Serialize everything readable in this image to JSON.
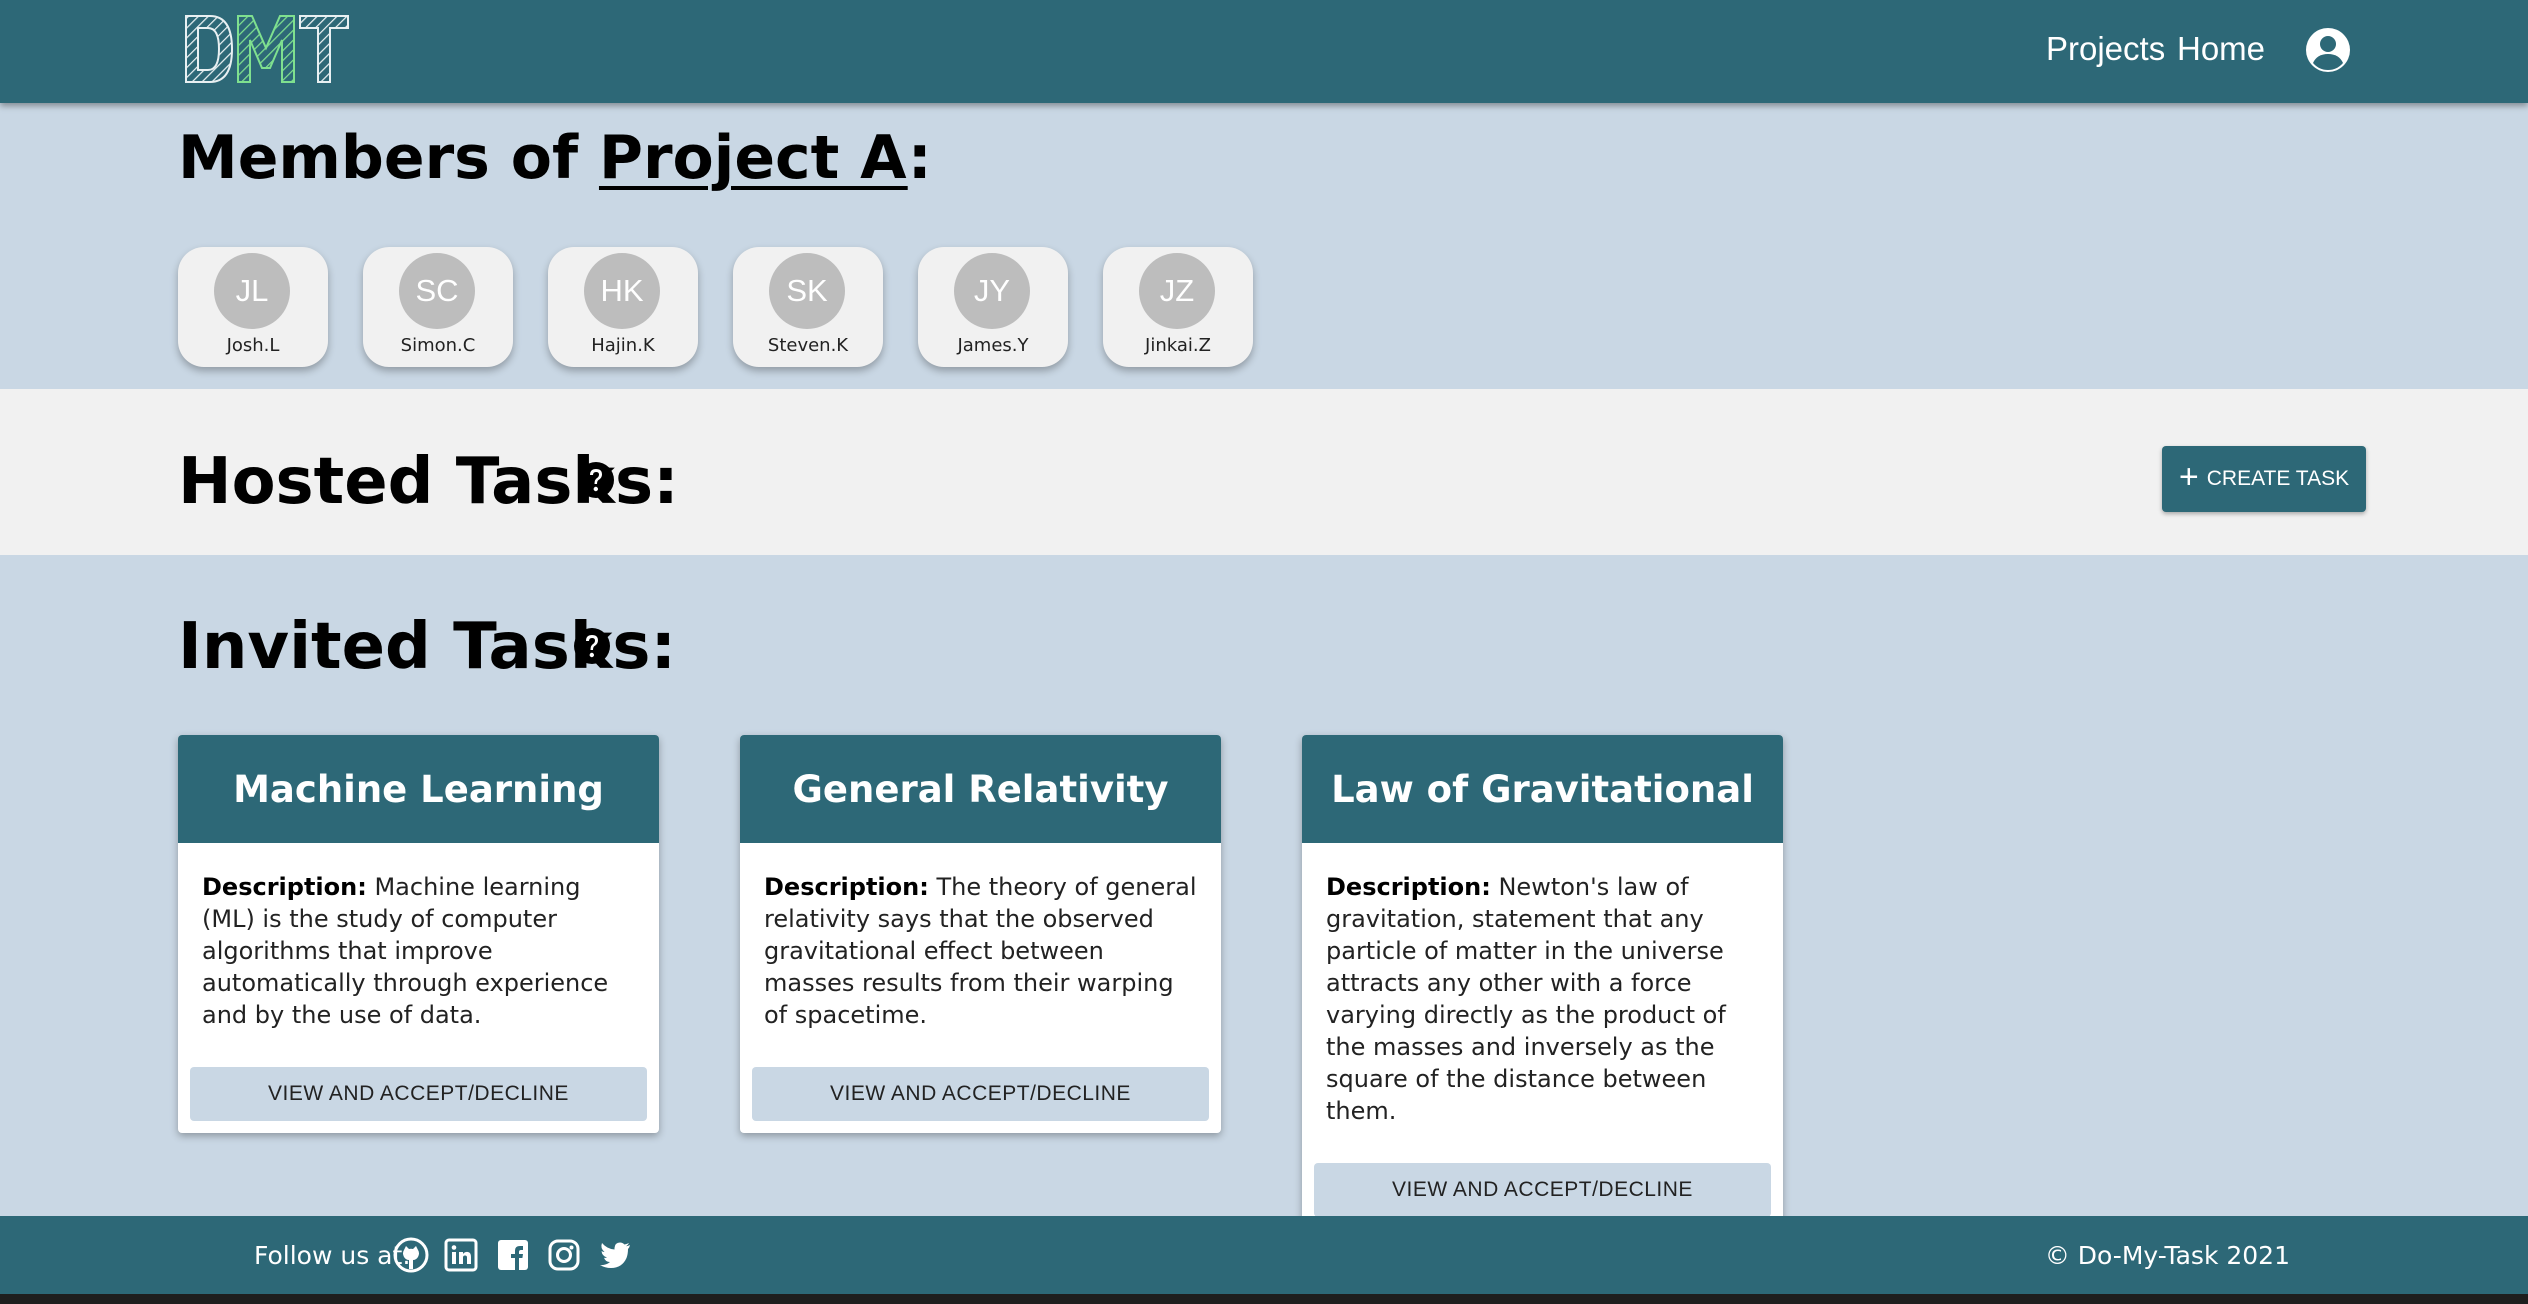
{
  "header": {
    "logo_text": "DMT",
    "nav": [
      {
        "label": "Projects"
      },
      {
        "label": "Home"
      }
    ],
    "account_icon": "account-circle-icon"
  },
  "members": {
    "title_prefix": "Members of ",
    "project_name": "Project A",
    "title_suffix": ":",
    "list": [
      {
        "initials": "JL",
        "name": "Josh.L"
      },
      {
        "initials": "SC",
        "name": "Simon.C"
      },
      {
        "initials": "HK",
        "name": "Hajin.K"
      },
      {
        "initials": "SK",
        "name": "Steven.K"
      },
      {
        "initials": "JY",
        "name": "James.Y"
      },
      {
        "initials": "JZ",
        "name": "Jinkai.Z"
      }
    ]
  },
  "hosted": {
    "title": "Hosted Tasks:",
    "help_icon": "question-circle-icon",
    "create_label": "CREATE TASK"
  },
  "invited": {
    "title": "Invited Tasks:",
    "help_icon": "question-circle-icon",
    "tasks": [
      {
        "title": "Machine Learning",
        "desc_label": "Description:",
        "description": "Machine learning (ML) is the study of computer algorithms that improve automatically through experience and by the use of data.",
        "button": "VIEW AND ACCEPT/DECLINE"
      },
      {
        "title": "General Relativity",
        "desc_label": "Description:",
        "description": "The theory of general relativity says that the observed gravitational effect between masses results from their warping of spacetime.",
        "button": "VIEW AND ACCEPT/DECLINE"
      },
      {
        "title": "Law of Gravitational",
        "desc_label": "Description:",
        "description": "Newton's law of gravitation, statement that any particle of matter in the universe attracts any other with a force varying directly as the product of the masses and inversely as the square of the distance between them.",
        "button": "VIEW AND ACCEPT/DECLINE"
      }
    ]
  },
  "footer": {
    "follow_label": "Follow us at:",
    "social": [
      "github-icon",
      "linkedin-icon",
      "facebook-icon",
      "instagram-icon",
      "twitter-icon"
    ],
    "copyright": "© Do-My-Task 2021"
  },
  "colors": {
    "primary": "#2d6877",
    "page_bg": "#c9d7e4",
    "band_bg": "#f1f1f1",
    "avatar_bg": "#bdbdbd"
  }
}
